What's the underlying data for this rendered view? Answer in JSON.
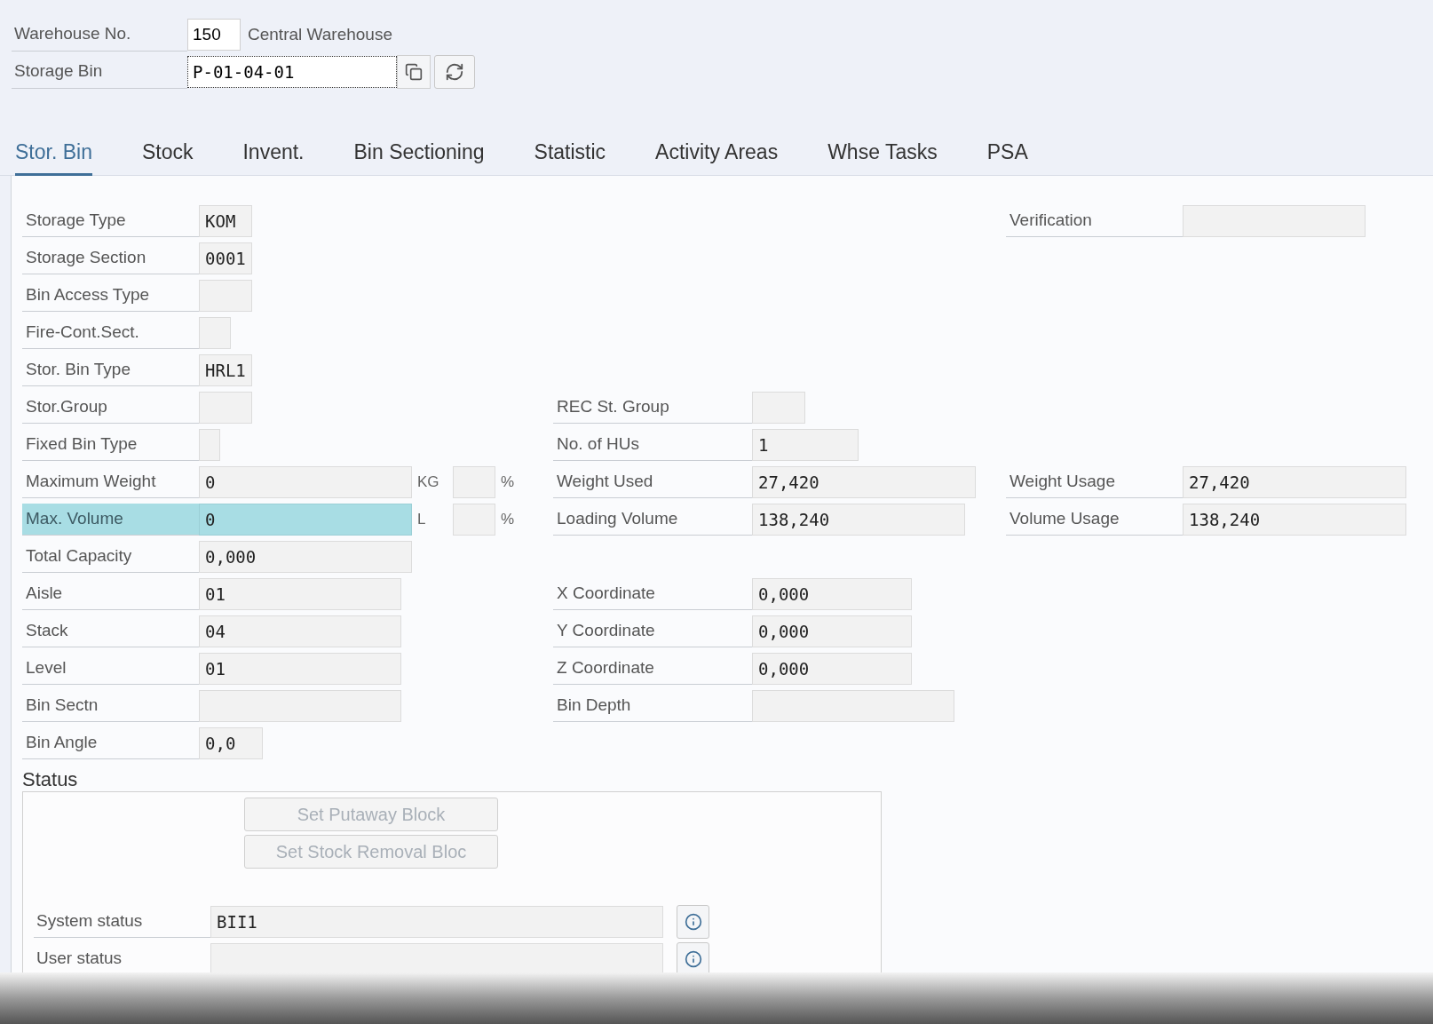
{
  "header": {
    "fields": [
      {
        "label": "Warehouse No.",
        "value": "150",
        "description": "Central Warehouse",
        "focused": false
      },
      {
        "label": "Storage Bin",
        "value": "P-01-04-01",
        "focused": true
      }
    ]
  },
  "tabs": [
    {
      "label": "Stor. Bin",
      "selected": true
    },
    {
      "label": "Stock",
      "selected": false
    },
    {
      "label": "Invent.",
      "selected": false
    },
    {
      "label": "Bin Sectioning",
      "selected": false
    },
    {
      "label": "Statistic",
      "selected": false
    },
    {
      "label": "Activity Areas",
      "selected": false
    },
    {
      "label": "Whse Tasks",
      "selected": false
    },
    {
      "label": "PSA",
      "selected": false
    }
  ],
  "rows": [
    {
      "left": {
        "label": "Storage Type",
        "value": "KOM",
        "focused": false
      },
      "right": {
        "label": "Verification",
        "focused": false
      }
    },
    {
      "left": {
        "label": "Storage Section",
        "value": "0001",
        "focused": false
      }
    },
    {
      "left": {
        "label": "Bin Access Type",
        "focused": false
      }
    },
    {
      "left": {
        "label": "Fire-Cont.Sect.",
        "focused": false
      }
    },
    {
      "left": {
        "label": "Stor. Bin Type",
        "value": "HRL1",
        "focused": false
      }
    },
    {
      "left": {
        "label": "Stor.Group",
        "focused": false
      },
      "middle": {
        "label": "REC St. Group",
        "focused": false
      }
    },
    {
      "left": {
        "label": "Fixed Bin Type",
        "focused": false
      },
      "middle": {
        "label": "No. of HUs",
        "value": "1",
        "focused": false
      }
    },
    {
      "left": {
        "label": "Maximum Weight",
        "value": "0",
        "unit": "KG",
        "percent_sign": "%",
        "focused": false
      },
      "middle": {
        "label": "Weight Used",
        "value": "27,420",
        "focused": false
      },
      "right": {
        "label": "Weight Usage",
        "value": "27,420",
        "focused": false
      }
    },
    {
      "left": {
        "label": "Max. Volume",
        "value": "0",
        "unit": "L",
        "percent_sign": "%",
        "focused": true
      },
      "middle": {
        "label": "Loading Volume",
        "value": "138,240",
        "focused": false
      },
      "right": {
        "label": "Volume Usage",
        "value": "138,240",
        "focused": false
      }
    },
    {
      "left": {
        "label": "Total Capacity",
        "value": "0,000",
        "focused": false
      }
    },
    {
      "left": {
        "label": "Aisle",
        "value": "01",
        "focused": false
      },
      "middle": {
        "label": "X Coordinate",
        "value": "0,000",
        "focused": false
      }
    },
    {
      "left": {
        "label": "Stack",
        "value": "04",
        "focused": false
      },
      "middle": {
        "label": "Y Coordinate",
        "value": "0,000",
        "focused": false
      }
    },
    {
      "left": {
        "label": "Level",
        "value": "01",
        "focused": false
      },
      "middle": {
        "label": "Z Coordinate",
        "value": "0,000",
        "focused": false
      }
    },
    {
      "left": {
        "label": "Bin Sectn",
        "focused": false
      },
      "middle": {
        "label": "Bin Depth",
        "focused": false
      }
    },
    {
      "left": {
        "label": "Bin Angle",
        "value": "0,0",
        "focused": false
      }
    }
  ],
  "status": {
    "title": "Status",
    "buttons": [
      {
        "label": "Set Putaway Block",
        "disabled": true
      },
      {
        "label": "Set Stock Removal Bloc",
        "disabled": true
      }
    ],
    "fields": [
      {
        "label": "System status",
        "value": "BII1"
      },
      {
        "label": "User status"
      }
    ]
  }
}
